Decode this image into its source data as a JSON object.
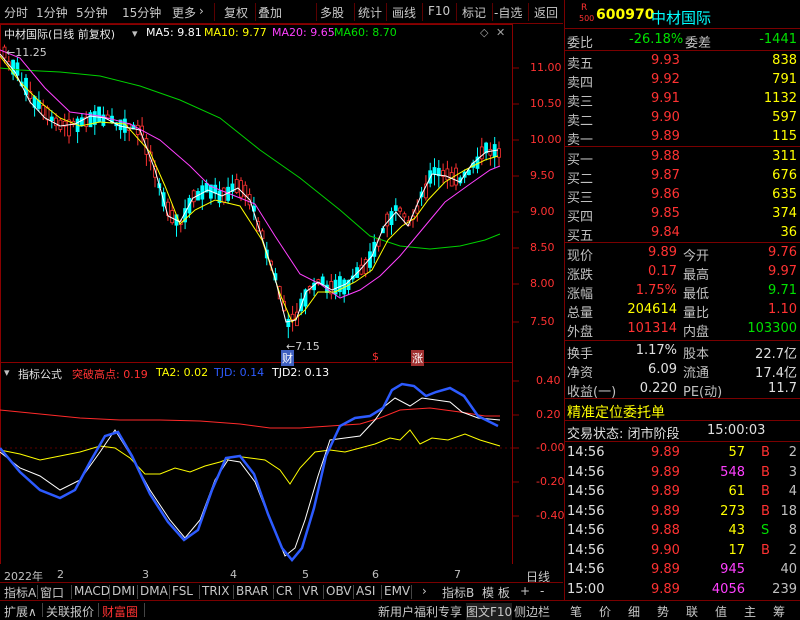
{
  "toolbar": {
    "periods": [
      "分时",
      "1分钟",
      "5分钟",
      "15分钟",
      "更多"
    ],
    "more_arrow": "›",
    "tools": [
      "复权",
      "叠加",
      "多股",
      "统计",
      "画线",
      "F10",
      "标记",
      "-自选",
      "返回"
    ]
  },
  "main_header": {
    "stock_label": "中材国际(日线 前复权)",
    "ma": [
      {
        "label": "MA5: 9.81",
        "color": "#ffffff"
      },
      {
        "label": "MA10: 9.77",
        "color": "#ffff00"
      },
      {
        "label": "MA20: 9.65",
        "color": "#ff40ff"
      },
      {
        "label": "MA60: 8.70",
        "color": "#00e000"
      }
    ]
  },
  "price_axis": [
    "11.00",
    "10.50",
    "10.00",
    "9.50",
    "9.00",
    "8.50",
    "8.00",
    "7.50"
  ],
  "annotations": {
    "high": "11.25",
    "low": "7.15",
    "fin": "财",
    "dollar": "$",
    "rise": "涨"
  },
  "indicator_header": {
    "name": "指标公式",
    "items": [
      {
        "label": "突破高点: 0.19",
        "color": "#ff3232"
      },
      {
        "label": "TA2: 0.02",
        "color": "#ffff00"
      },
      {
        "label": "TJD: 0.14",
        "color": "#2d5bff"
      },
      {
        "label": "TJD2: 0.13",
        "color": "#ffffff"
      }
    ]
  },
  "indicator_axis": [
    "0.40",
    "0.20",
    "-0.00",
    "-0.20",
    "-0.40"
  ],
  "date_axis": {
    "year": "2022年",
    "months": [
      "2",
      "3",
      "4",
      "5",
      "6",
      "7"
    ],
    "period": "日线"
  },
  "indicator_tabs": [
    "指标A",
    "窗口",
    "MACD",
    "DMI",
    "DMA",
    "FSL",
    "TRIX",
    "BRAR",
    "CR",
    "VR",
    "OBV",
    "ASI",
    "EMV"
  ],
  "indicator_tabs_tail": {
    "more": "›",
    "indb": "指标B",
    "template": "模 板",
    "plus": "+",
    "minus": "-"
  },
  "bottom_bar": {
    "left": [
      "扩展∧",
      "关联报价",
      "财富圈"
    ],
    "right": [
      "新用户福利专享",
      "图文F10",
      "侧边栏"
    ],
    "right_panel": [
      "笔",
      "价",
      "细",
      "势",
      "联",
      "值",
      "主",
      "筹"
    ]
  },
  "quote": {
    "code": "600970",
    "name": "中材国际",
    "rank_top": "R",
    "rank_bottom": "500",
    "wei_bi_label": "委比",
    "wei_bi": "-26.18%",
    "wei_cha_label": "委差",
    "wei_cha": "-1441",
    "asks": [
      {
        "label": "卖五",
        "price": "9.93",
        "vol": "838"
      },
      {
        "label": "卖四",
        "price": "9.92",
        "vol": "791"
      },
      {
        "label": "卖三",
        "price": "9.91",
        "vol": "1132"
      },
      {
        "label": "卖二",
        "price": "9.90",
        "vol": "597"
      },
      {
        "label": "卖一",
        "price": "9.89",
        "vol": "115"
      }
    ],
    "bids": [
      {
        "label": "买一",
        "price": "9.88",
        "vol": "311"
      },
      {
        "label": "买二",
        "price": "9.87",
        "vol": "676"
      },
      {
        "label": "买三",
        "price": "9.86",
        "vol": "635"
      },
      {
        "label": "买四",
        "price": "9.85",
        "vol": "374"
      },
      {
        "label": "买五",
        "price": "9.84",
        "vol": "36"
      }
    ],
    "stats": [
      {
        "l1": "现价",
        "v1": "9.89",
        "l2": "今开",
        "v2": "9.76",
        "c1": "#ff3232",
        "c2": "#ff3232"
      },
      {
        "l1": "涨跌",
        "v1": "0.17",
        "l2": "最高",
        "v2": "9.97",
        "c1": "#ff3232",
        "c2": "#ff3232"
      },
      {
        "l1": "涨幅",
        "v1": "1.75%",
        "l2": "最低",
        "v2": "9.71",
        "c1": "#ff3232",
        "c2": "#00e000"
      },
      {
        "l1": "总量",
        "v1": "204614",
        "l2": "量比",
        "v2": "1.10",
        "c1": "#ffff00",
        "c2": "#ff3232"
      },
      {
        "l1": "外盘",
        "v1": "101314",
        "l2": "内盘",
        "v2": "103300",
        "c1": "#ff3232",
        "c2": "#00e000"
      }
    ],
    "stats2": [
      {
        "l1": "换手",
        "v1": "1.17%",
        "l2": "股本",
        "v2": "22.7亿"
      },
      {
        "l1": "净资",
        "v1": "6.09",
        "l2": "流通",
        "v2": "17.4亿"
      },
      {
        "l1": "收益(一)",
        "v1": "0.220",
        "l2": "PE(动)",
        "v2": "11.7"
      }
    ],
    "precise_label": "精准定位委托单",
    "trade_state": "交易状态: 闭市阶段",
    "trade_time": "15:00:03",
    "ticks": [
      {
        "t": "14:56",
        "p": "9.89",
        "v": "57",
        "bs": "B",
        "n": "2",
        "vc": "#ffff00",
        "bc": "#ff3232"
      },
      {
        "t": "14:56",
        "p": "9.89",
        "v": "548",
        "bs": "B",
        "n": "3",
        "vc": "#ff40ff",
        "bc": "#ff3232"
      },
      {
        "t": "14:56",
        "p": "9.89",
        "v": "61",
        "bs": "B",
        "n": "4",
        "vc": "#ffff00",
        "bc": "#ff3232"
      },
      {
        "t": "14:56",
        "p": "9.89",
        "v": "273",
        "bs": "B",
        "n": "18",
        "vc": "#ffff00",
        "bc": "#ff3232"
      },
      {
        "t": "14:56",
        "p": "9.88",
        "v": "43",
        "bs": "S",
        "n": "8",
        "vc": "#ffff00",
        "bc": "#00e000"
      },
      {
        "t": "14:56",
        "p": "9.90",
        "v": "17",
        "bs": "B",
        "n": "2",
        "vc": "#ffff00",
        "bc": "#ff3232"
      },
      {
        "t": "14:56",
        "p": "9.89",
        "v": "945",
        "bs": "",
        "n": "40",
        "vc": "#ff40ff",
        "bc": "#ff3232"
      },
      {
        "t": "15:00",
        "p": "9.89",
        "v": "4056",
        "bs": "",
        "n": "239",
        "vc": "#ff40ff",
        "bc": "#ff3232"
      }
    ]
  }
}
